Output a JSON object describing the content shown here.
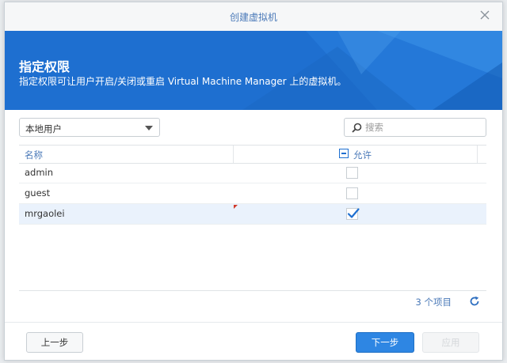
{
  "dialog": {
    "title": "创建虚拟机",
    "close_icon": "close-icon"
  },
  "banner": {
    "heading": "指定权限",
    "description": "指定权限可让用户开启/关闭或重启 Virtual Machine Manager 上的虚拟机。",
    "color": "#1e6fd0"
  },
  "filter": {
    "user_type_selected": "本地用户",
    "search_placeholder": "搜索",
    "search_value": ""
  },
  "table": {
    "columns": {
      "name": "名称",
      "allow": "允许"
    },
    "header_allow_state": "indeterminate",
    "rows": [
      {
        "name": "admin",
        "allowed": false,
        "selected": false
      },
      {
        "name": "guest",
        "allowed": false,
        "selected": false
      },
      {
        "name": "mrgaolei",
        "allowed": true,
        "selected": true
      }
    ],
    "item_count": "3 个项目"
  },
  "buttons": {
    "back": "上一步",
    "next": "下一步",
    "disabled_label": "应用"
  },
  "colors": {
    "accent": "#2e86e3",
    "link_text": "#4a79b8",
    "selected_row": "#eaf2fc"
  }
}
